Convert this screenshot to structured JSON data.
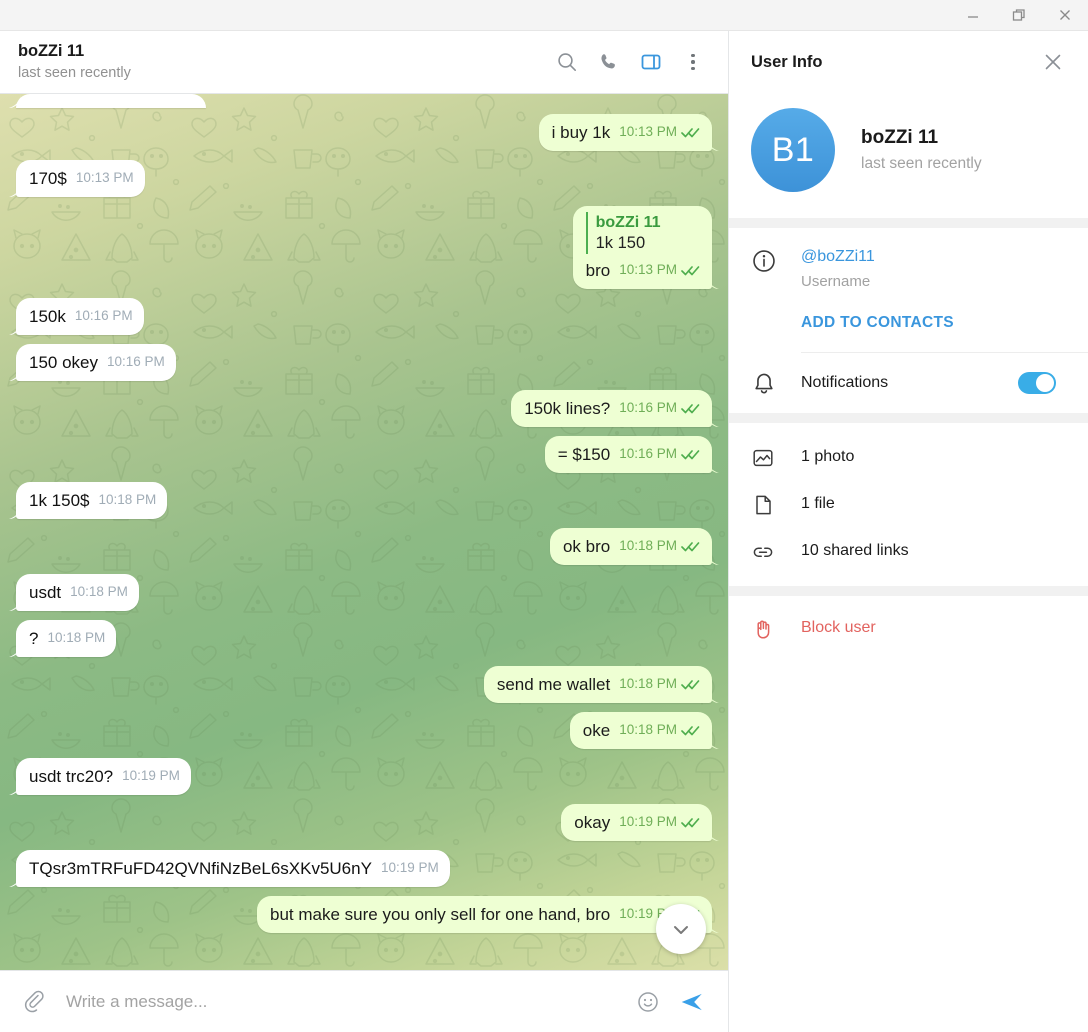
{
  "window": {
    "minimize_label": "Minimize",
    "restore_label": "Restore",
    "close_label": "Close"
  },
  "chat_header": {
    "title": "boZZi 11",
    "subtitle": "last seen recently",
    "actions": [
      "search-icon",
      "phone-icon",
      "info-panel-icon",
      "more-icon"
    ]
  },
  "messages": [
    {
      "dir": "in",
      "text": "",
      "time": "",
      "partial": true
    },
    {
      "dir": "out",
      "text": "i buy 1k",
      "time": "10:13 PM",
      "status": "read"
    },
    {
      "dir": "in",
      "text": "170$",
      "time": "10:13 PM"
    },
    {
      "dir": "out",
      "text": "bro",
      "time": "10:13 PM",
      "status": "read",
      "reply": {
        "name": "boZZi 11",
        "text": "1k 150"
      }
    },
    {
      "dir": "in",
      "text": "150k",
      "time": "10:16 PM"
    },
    {
      "dir": "in",
      "text": "150 okey",
      "time": "10:16 PM"
    },
    {
      "dir": "out",
      "text": "150k lines?",
      "time": "10:16 PM",
      "status": "read"
    },
    {
      "dir": "out",
      "text": "= $150",
      "time": "10:16 PM",
      "status": "read"
    },
    {
      "dir": "in",
      "text": "1k 150$",
      "time": "10:18 PM"
    },
    {
      "dir": "out",
      "text": "ok bro",
      "time": "10:18 PM",
      "status": "read"
    },
    {
      "dir": "in",
      "text": "usdt",
      "time": "10:18 PM"
    },
    {
      "dir": "in",
      "text": "?",
      "time": "10:18 PM"
    },
    {
      "dir": "out",
      "text": "send me wallet",
      "time": "10:18 PM",
      "status": "read"
    },
    {
      "dir": "out",
      "text": "oke",
      "time": "10:18 PM",
      "status": "read"
    },
    {
      "dir": "in",
      "text": "usdt trc20?",
      "time": "10:19 PM"
    },
    {
      "dir": "out",
      "text": "okay",
      "time": "10:19 PM",
      "status": "read"
    },
    {
      "dir": "in",
      "text": "TQsr3mTRFuFD42QVNfiNzBeL6sXKv5U6nY",
      "time": "10:19 PM"
    },
    {
      "dir": "out",
      "text": "but make sure you only sell for one hand, bro",
      "time": "10:19 PM",
      "status": "read"
    }
  ],
  "scroll_down_button": {
    "icon": "chevron-down-icon"
  },
  "composer": {
    "attach_icon": "paperclip-icon",
    "placeholder": "Write a message...",
    "value": "",
    "emoji_icon": "smiley-icon",
    "send_icon": "send-icon"
  },
  "info_panel": {
    "title": "User Info",
    "close_icon": "close-icon",
    "avatar_initials": "B1",
    "name": "boZZi 11",
    "status": "last seen recently",
    "username_value": "@boZZi11",
    "username_label": "Username",
    "add_to_contacts": "ADD TO CONTACTS",
    "notifications_label": "Notifications",
    "notifications_on": true,
    "media": [
      {
        "icon": "photo-icon",
        "label": "1 photo"
      },
      {
        "icon": "file-icon",
        "label": "1 file"
      },
      {
        "icon": "link-icon",
        "label": "10 shared links"
      }
    ],
    "block_label": "Block user",
    "block_icon": "hand-stop-icon"
  },
  "colors": {
    "accent_blue": "#3a96dd",
    "toggle_on": "#39ade7",
    "outgoing_bubble": "#eeffd3",
    "incoming_bubble": "#ffffff",
    "read_tick": "#4fae4e",
    "danger_red": "#e2635f",
    "reply_bar": "#4caf50"
  }
}
